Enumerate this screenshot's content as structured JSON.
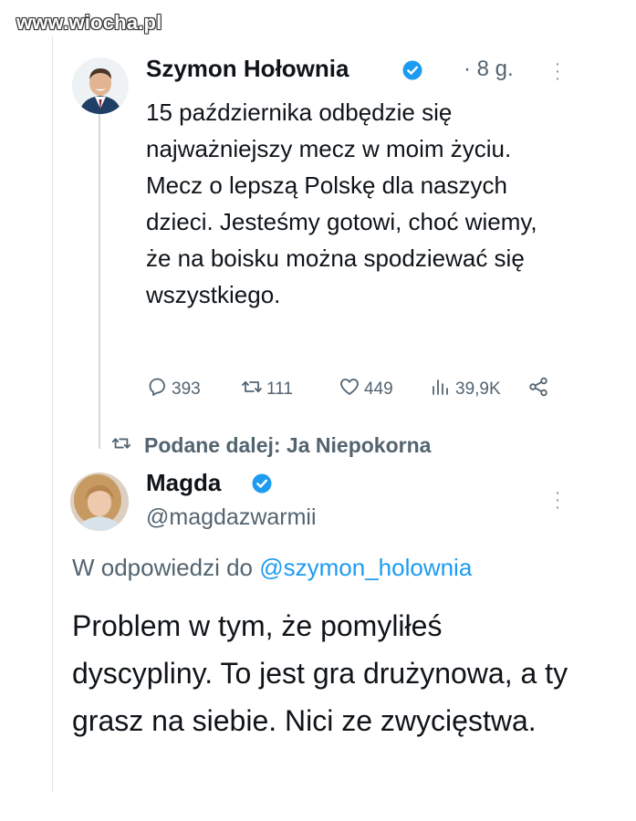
{
  "watermark": "www.wiocha.pl",
  "tweet": {
    "author": "Szymon Hołownia",
    "time": "· 8 g.",
    "text": "15 października odbędzie się najważniejszy mecz w moim życiu. Mecz o lepszą Polskę dla naszych dzieci. Jesteśmy gotowi, choć wiemy, że na boisku można spodziewać się wszystkiego.",
    "stats": {
      "replies": "393",
      "retweets": "111",
      "likes": "449",
      "views": "39,9K"
    }
  },
  "retweet_label": "Podane dalej: Ja Niepokorna",
  "reply": {
    "author": "Magda",
    "handle": "@magdazwarmii",
    "replying_to_prefix": "W odpowiedzi do",
    "replying_to_handle": "@szymon_holownia",
    "text": "Problem w tym, że pomyliłeś dyscypliny. To jest gra drużynowa, a ty grasz na siebie. Nici ze zwycięstwa."
  },
  "icons": {
    "verified": "verified-badge-icon",
    "more": "more-options-icon",
    "reply": "reply-icon",
    "retweet": "retweet-icon",
    "like": "heart-icon",
    "views": "views-icon",
    "share": "share-icon"
  },
  "colors": {
    "text": "#0f1419",
    "secondary": "#536471",
    "accent": "#1d9bf0",
    "verified": "#1d9bf0"
  }
}
